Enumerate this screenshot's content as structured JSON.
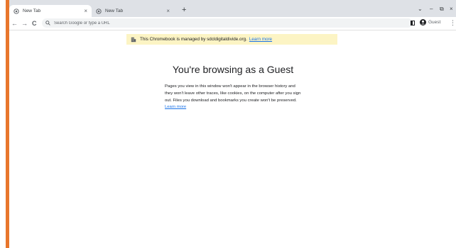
{
  "browser": {
    "tabs": [
      {
        "title": "New Tab",
        "active": true
      },
      {
        "title": "New Tab",
        "active": false
      }
    ],
    "tab_close_glyph": "×",
    "new_tab_glyph": "+",
    "window_controls": {
      "search_tabs": "⌄",
      "minimize": "–",
      "maximize": "⧉",
      "close": "×"
    },
    "nav": {
      "back": "←",
      "forward": "→",
      "reload": "C"
    },
    "omnibox": {
      "placeholder": "Search Google or type a URL"
    },
    "profile": {
      "label": "Guest"
    },
    "menu_glyph": "⋮"
  },
  "managed_banner": {
    "text": "This Chromebook is managed by sdcldigitaldivide.org.",
    "link": "Learn more"
  },
  "guest": {
    "title": "You're browsing as a Guest",
    "body": "Pages you view in this window won't appear in the browser history and they won't leave other traces, like cookies, on the computer after you sign out. Files you download and bookmarks you create won't be preserved.",
    "link": "Learn more"
  },
  "colors": {
    "accent_bar": "#e8762c",
    "tab_strip": "#dee1e6",
    "banner": "#fcf4c4",
    "link": "#1a73e8"
  },
  "icons": {
    "tab_favicon": "chrome-globe-icon",
    "search": "search-icon",
    "banner": "building-icon",
    "profile": "profile-icon",
    "side_panel": "side-panel-icon"
  }
}
